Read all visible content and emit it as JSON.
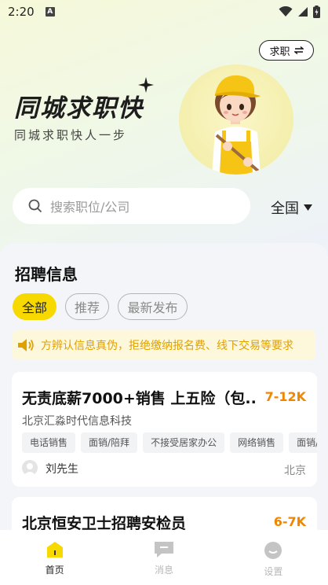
{
  "status_bar": {
    "time": "2:20",
    "notif_letter": "A"
  },
  "header": {
    "mode_button": "求职",
    "title": "同城求职快",
    "subtitle": "同城求职快人一步"
  },
  "search": {
    "placeholder": "搜索职位/公司",
    "region": "全国"
  },
  "section": {
    "title": "招聘信息"
  },
  "filters": [
    {
      "label": "全部",
      "active": true
    },
    {
      "label": "推荐",
      "active": false
    },
    {
      "label": "最新发布",
      "active": false
    }
  ],
  "notice": {
    "text": "方辨认信息真伪，拒绝缴纳报名费、线下交易等要求"
  },
  "jobs": [
    {
      "title": "无责底薪7000+销售 上五险（包...",
      "salary": "7-12K",
      "company": "北京汇淼时代信息科技",
      "tags": [
        "电话销售",
        "面销/陪拜",
        "不接受居家办公",
        "网络销售",
        "面销/"
      ],
      "recruiter": "刘先生",
      "location": "北京"
    },
    {
      "title": "北京恒安卫士招聘安检员",
      "salary": "6-7K"
    }
  ],
  "nav": [
    {
      "label": "首页",
      "icon": "home-icon",
      "active": true
    },
    {
      "label": "消息",
      "icon": "message-icon",
      "active": false
    },
    {
      "label": "设置",
      "icon": "settings-icon",
      "active": false
    }
  ],
  "colors": {
    "accent_yellow": "#f7d900",
    "salary_orange": "#f08500",
    "notice_text": "#e0a100",
    "notice_bg": "#fdf8dc"
  }
}
